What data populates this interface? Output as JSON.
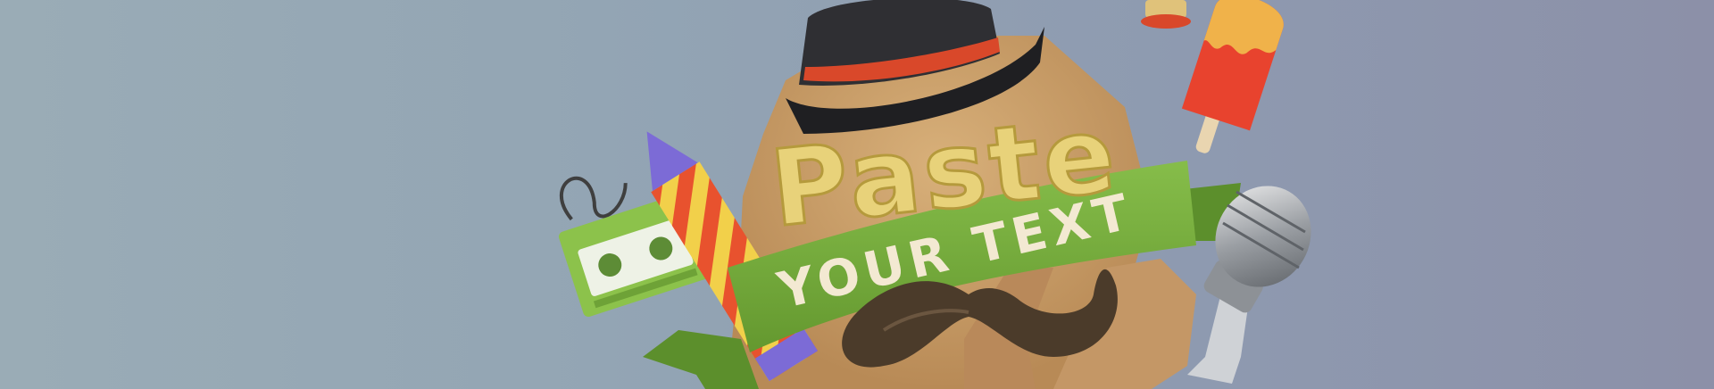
{
  "banner": {
    "headline": "Paste",
    "ribbon_text": "YOUR TEXT",
    "colors": {
      "background": "#93a5b4",
      "cardboard": "#c9a06c",
      "ribbon": "#7ab241",
      "hat": "#2b2b2e",
      "hat_band": "#d9482a",
      "popsicle": "#e8432e"
    },
    "props": [
      "cassette-tape",
      "firework-rocket",
      "bowler-hat",
      "popsicle",
      "microphone",
      "mustache",
      "cardboard-badge"
    ]
  }
}
